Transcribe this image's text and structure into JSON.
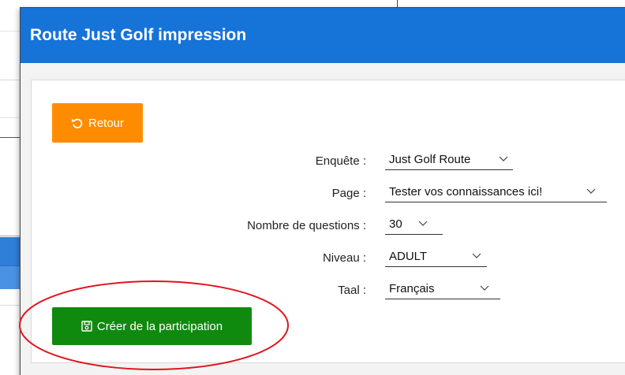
{
  "modal": {
    "title": "Route Just Golf impression"
  },
  "back_button": {
    "label": "Retour",
    "icon": "undo-icon"
  },
  "form": {
    "enquete": {
      "label": "Enquête :",
      "value": "Just Golf Route"
    },
    "page": {
      "label": "Page :",
      "value": "Tester vos connaissances ici!"
    },
    "nombre": {
      "label": "Nombre de questions :",
      "value": "30"
    },
    "niveau": {
      "label": "Niveau :",
      "value": "ADULT"
    },
    "taal": {
      "label": "Taal :",
      "value": "Français"
    }
  },
  "create_button": {
    "label": "Créer de la participation",
    "icon": "save-icon"
  },
  "colors": {
    "header": "#1673d8",
    "back_button": "#ff8c00",
    "create_button": "#0f8a0f",
    "annotation": "#e0141e"
  }
}
